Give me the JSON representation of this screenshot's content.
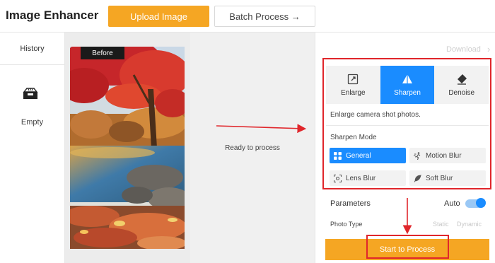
{
  "app": {
    "title": "Image Enhancer"
  },
  "toolbar": {
    "upload_label": "Upload Image",
    "batch_label": "Batch Process →"
  },
  "sidebar": {
    "history_tab": "History",
    "empty_label": "Empty",
    "empty_icon": "inbox-tray-icon"
  },
  "preview": {
    "before_badge": "Before"
  },
  "status": {
    "message": "Ready to process"
  },
  "panel": {
    "download_label": "Download",
    "tabs": [
      {
        "label": "Enlarge",
        "icon": "expand-arrows-icon",
        "active": false
      },
      {
        "label": "Sharpen",
        "icon": "sharpen-prism-icon",
        "active": true
      },
      {
        "label": "Denoise",
        "icon": "eraser-icon",
        "active": false
      }
    ],
    "description": "Enlarge camera shot photos.",
    "sharpen_mode_label": "Sharpen Mode",
    "sharpen_options": [
      {
        "label": "General",
        "icon": "grid-icon",
        "active": true
      },
      {
        "label": "Motion Blur",
        "icon": "running-figure-icon",
        "active": false
      },
      {
        "label": "Lens Blur",
        "icon": "lens-focus-icon",
        "active": false
      },
      {
        "label": "Soft Blur",
        "icon": "feather-icon",
        "active": false
      }
    ],
    "parameters_label": "Parameters",
    "auto_label": "Auto",
    "auto_enabled": true,
    "photo_type_label": "Photo Type",
    "photo_type_options": [
      "Static",
      "Dynamic"
    ],
    "start_label": "Start to Process"
  },
  "colors": {
    "accent": "#f5a623",
    "primary_blue": "#1a8cff",
    "annotation_red": "#e0262b"
  }
}
